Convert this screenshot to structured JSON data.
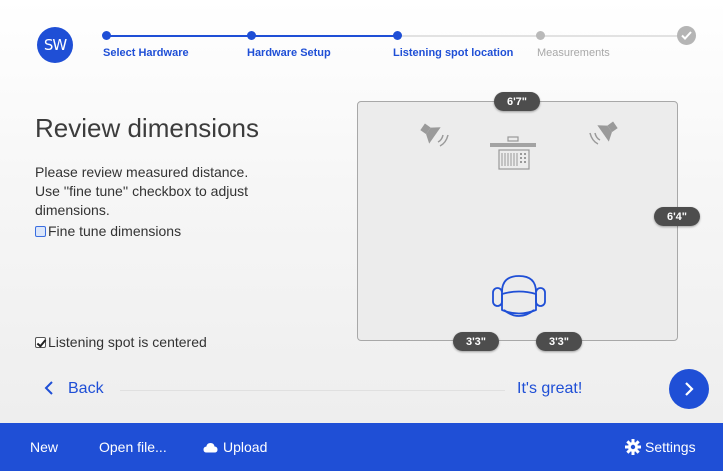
{
  "logo": {
    "text": "SW"
  },
  "stepper": {
    "steps": [
      {
        "label": "Select Hardware",
        "state": "done"
      },
      {
        "label": "Hardware Setup",
        "state": "done"
      },
      {
        "label": "Listening spot location",
        "state": "current"
      },
      {
        "label": "Measurements",
        "state": "todo"
      }
    ],
    "final_icon": "check-icon"
  },
  "main": {
    "title": "Review dimensions",
    "description": "Please review measured distance. Use ''fine tune'' checkbox to adjust dimensions.",
    "fine_tune": {
      "label": "Fine tune dimensions",
      "checked": false
    },
    "centered": {
      "label": "Listening spot is centered",
      "checked": true
    }
  },
  "room": {
    "width_label": "6'7\"",
    "depth_label": "6'4\"",
    "left_offset_label": "3'3\"",
    "right_offset_label": "3'3\"",
    "icons": [
      "left-speaker-icon",
      "right-speaker-icon",
      "sound-device-icon",
      "chair-icon"
    ]
  },
  "nav": {
    "back_label": "Back",
    "confirm_label": "It's great!",
    "next_icon": "chevron-right-icon"
  },
  "bottombar": {
    "new_label": "New",
    "open_label": "Open file...",
    "upload_label": "Upload",
    "upload_icon": "cloud-icon",
    "settings_label": "Settings",
    "settings_icon": "gear-icon"
  },
  "colors": {
    "accent": "#1f4fd6",
    "pill": "#4d4d4d",
    "muted": "#a8a8a8"
  }
}
